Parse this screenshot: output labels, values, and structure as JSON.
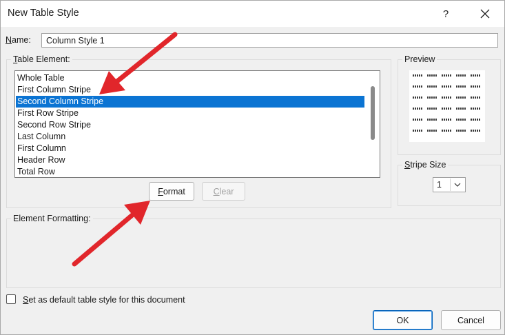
{
  "window": {
    "title": "New Table Style",
    "help_glyph": "?"
  },
  "name_field": {
    "label_prefix": "",
    "label_accel": "N",
    "label_rest": "ame:",
    "value": "Column Style 1"
  },
  "table_element": {
    "label_accel": "T",
    "label_rest": "able Element:",
    "items": [
      "Whole Table",
      "First Column Stripe",
      "Second Column Stripe",
      "First Row Stripe",
      "Second Row Stripe",
      "Last Column",
      "First Column",
      "Header Row",
      "Total Row"
    ],
    "selected_index": 2
  },
  "buttons": {
    "format_accel": "F",
    "format_rest": "ormat",
    "clear_accel": "C",
    "clear_rest": "lear",
    "ok": "OK",
    "cancel": "Cancel"
  },
  "preview": {
    "label": "Preview"
  },
  "stripe_size": {
    "label_prefix": "",
    "label_accel": "S",
    "label_rest": "tripe Size",
    "value": "1"
  },
  "element_formatting": {
    "label": "Element Formatting:"
  },
  "default_checkbox": {
    "checked": false,
    "label_accel": "S",
    "label_rest": "et as default table style for this document"
  },
  "colors": {
    "selection": "#0b74d3",
    "annotation_arrow": "#e1262b",
    "ok_border": "#005fb8"
  }
}
